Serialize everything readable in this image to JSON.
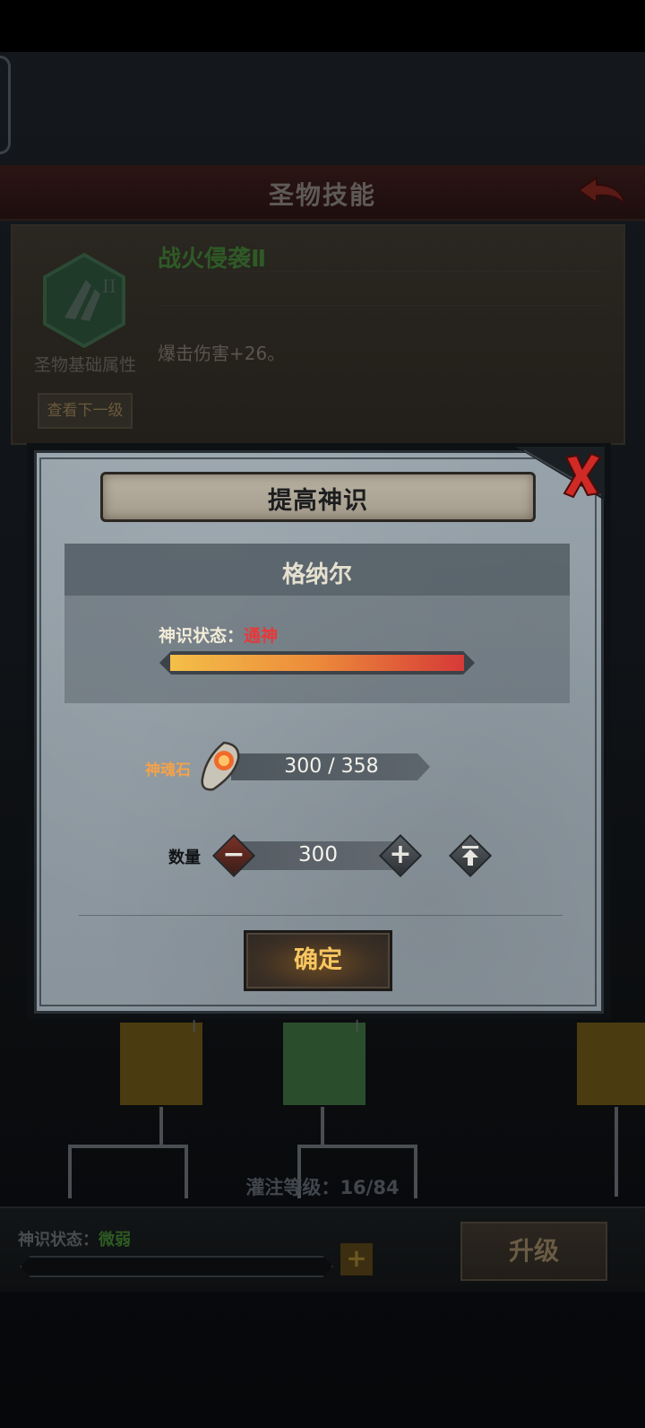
{
  "background": {
    "header_title": "圣物技能",
    "skill": {
      "name": "战火侵袭Ⅱ",
      "icon_badge": "II",
      "description": "爆击伤害+26。",
      "caption": "圣物基础属性",
      "next_level_button": "查看下一级"
    },
    "node_badges": [
      "I",
      "I"
    ],
    "infusion_level_label": "灌注等级：",
    "infusion_level_value": "16/84",
    "status_label": "神识状态：",
    "status_value": "微弱",
    "upgrade_button": "升级",
    "plus_button": "+"
  },
  "dialog": {
    "title": "提高神识",
    "target_name": "格纳尔",
    "state_label": "神识状态：",
    "state_value": "通神",
    "state_progress": 1.0,
    "state_bar_colors": [
      "#f4bf48",
      "#ec8a3a",
      "#d63a38"
    ],
    "stone_label": "神魂石",
    "stone_count": "300 / 358",
    "quantity_label": "数量",
    "quantity_value": "300",
    "minus_glyph": "−",
    "plus_glyph": "+",
    "confirm_button": "确定"
  },
  "icons": {
    "close": "close-x-icon",
    "back": "back-arrow-icon",
    "stone": "soul-stone-icon",
    "max": "max-arrow-icon"
  }
}
